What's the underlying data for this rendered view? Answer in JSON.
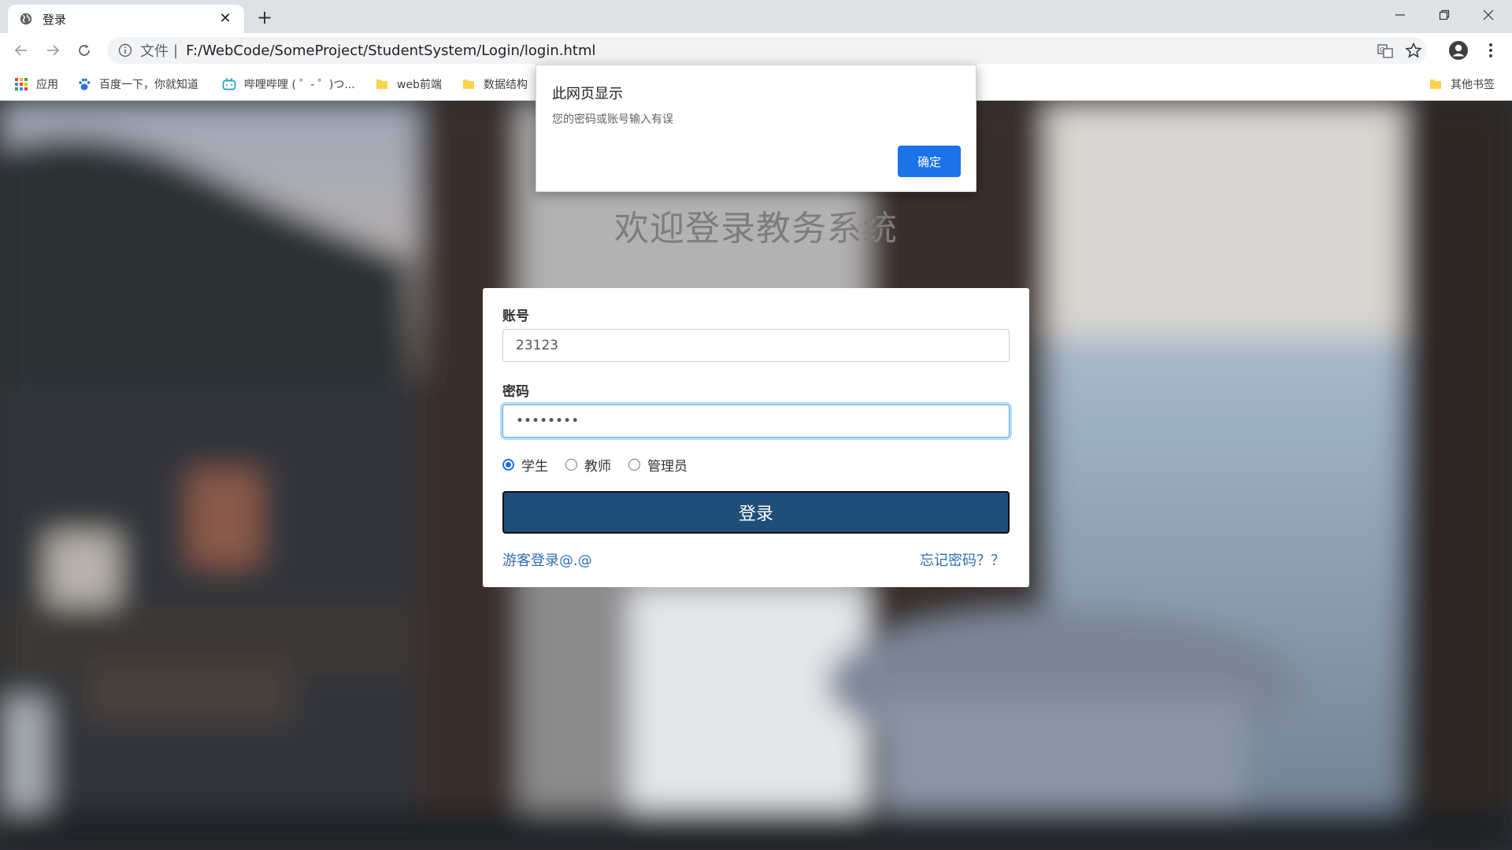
{
  "browser": {
    "tab_title": "登录",
    "url_scheme": "文件",
    "url_separator": "|",
    "url": "F:/WebCode/SomeProject/StudentSystem/Login/login.html"
  },
  "bookmarks": [
    {
      "label": "应用",
      "icon": "apps-grid-icon"
    },
    {
      "label": "百度一下，你就知道",
      "icon": "baidu-paw-icon"
    },
    {
      "label": "哔哩哔哩 ( ゜- ゜)つ...",
      "icon": "bilibili-icon"
    },
    {
      "label": "web前端",
      "icon": "folder-icon"
    },
    {
      "label": "数据结构",
      "icon": "folder-icon"
    },
    {
      "label": "其他书签",
      "icon": "folder-icon"
    }
  ],
  "page": {
    "title": "欢迎登录教务系统",
    "account_label": "账号",
    "account_value": "23123",
    "password_label": "密码",
    "password_value": "••••••••",
    "roles": [
      {
        "label": "学生",
        "checked": true
      },
      {
        "label": "教师",
        "checked": false
      },
      {
        "label": "管理员",
        "checked": false
      }
    ],
    "login_button": "登录",
    "guest_link": "游客登录@.@",
    "forgot_link": "忘记密码？？"
  },
  "dialog": {
    "title": "此网页显示",
    "message": "您的密码或账号输入有误",
    "ok_button": "确定"
  },
  "colors": {
    "primary_button": "#1f4e79",
    "dialog_button": "#1a73e8",
    "link": "#2f6fb0"
  }
}
